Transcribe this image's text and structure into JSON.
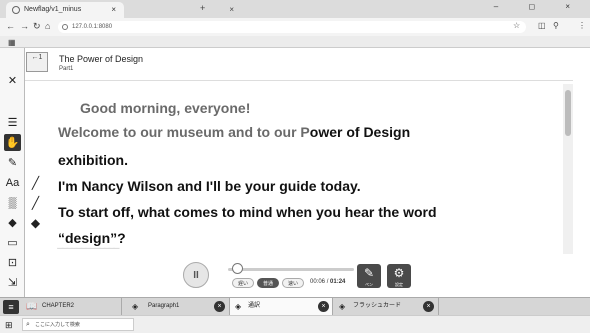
{
  "browser": {
    "tab_title": "Newflag/v1_minus",
    "tab2_close": "×",
    "new_tab": "+",
    "window_controls": "–  ◻  ×",
    "url": "127.0.0.1:8080",
    "tab_close": "×"
  },
  "header": {
    "unit_icon_text": "←1",
    "title": "The Power of Design",
    "part": "Part1"
  },
  "content": {
    "lines": [
      {
        "parts": [
          {
            "text": "Good morning, everyone!",
            "style": "gray"
          }
        ]
      },
      {
        "parts": [
          {
            "text": "Welcome to our museum and to our P",
            "style": "gray"
          },
          {
            "text": "ower of Design",
            "style": "dark"
          }
        ]
      },
      {
        "parts": [
          {
            "text": "exhibition.",
            "style": "dark"
          }
        ]
      },
      {
        "parts": [
          {
            "text": "I'm Nancy Wilson and I'll be your guide today.",
            "style": "dark"
          }
        ]
      },
      {
        "parts": [
          {
            "text": "To start off, what comes to mind when you hear the word",
            "style": "dark"
          }
        ]
      },
      {
        "parts": [
          {
            "text": "“design”?",
            "style": "dark"
          }
        ]
      }
    ]
  },
  "player": {
    "play_glyph": "II",
    "speed_slow": "遅い",
    "speed_normal": "普通",
    "speed_fast": "速い",
    "time_current": "00:06",
    "time_total": "01:24",
    "pen_label": "ペン",
    "settings_label": "設定",
    "progress": 0.05
  },
  "bottom_tabs": {
    "chapter": "CHAPTER2",
    "paragraph": "Paragraph1",
    "translation": "通訳",
    "flashcard": "フラッシュカード",
    "close": "×"
  },
  "taskbar": {
    "search_placeholder": "ここに入力して検索"
  },
  "icons": {
    "close": "close-icon",
    "hand": "hand-icon",
    "pen": "pen-icon",
    "marker": "marker-icon",
    "eraser": "eraser-icon",
    "settings": "gear-icon"
  },
  "colors": {
    "dark_text": "#111111",
    "read_text": "#6a6a6a",
    "button_dark": "#4a4a4a"
  }
}
